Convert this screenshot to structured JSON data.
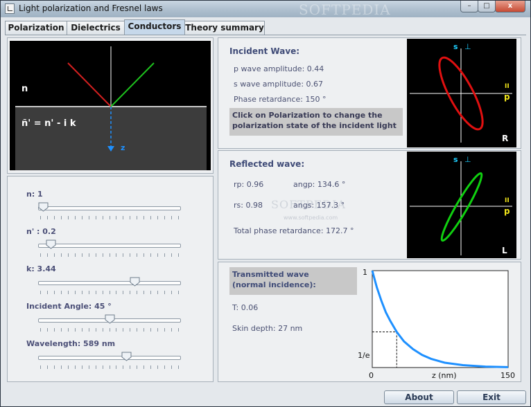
{
  "window": {
    "title": "Light polarization and Fresnel laws",
    "watermark": "SOFTPEDIA",
    "controls": {
      "minimize": "–",
      "maximize": "□",
      "close": "x"
    }
  },
  "tabs": [
    {
      "label": "Polarization",
      "active": false
    },
    {
      "label": "Dielectrics",
      "active": false
    },
    {
      "label": "Conductors",
      "active": true
    },
    {
      "label": "Theory summary",
      "active": false
    }
  ],
  "diagram": {
    "n_label": "n",
    "complex_n_label": "ñ' = n' - i k",
    "z_label": "z",
    "colors": {
      "incident": "#d42020",
      "reflected": "#1ec21e",
      "axis": "#1e90ff"
    }
  },
  "sliders": [
    {
      "label": "n: 1",
      "value": 0.0
    },
    {
      "label": "n' : 0.2",
      "value": 0.06
    },
    {
      "label": "k: 3.44",
      "value": 0.69
    },
    {
      "label": "Incident Angle: 45 °",
      "value": 0.5
    },
    {
      "label": "Wavelength: 589 nm",
      "value": 0.63
    }
  ],
  "incident": {
    "header": "Incident Wave:",
    "p_amp": "p wave amplitude: 0.44",
    "s_amp": "s wave amplitude: 0.67",
    "phase": "Phase retardance: 150 °",
    "note_line1": "Click on Polarization to change the",
    "note_line2": "polarization state of the incident light",
    "plot": {
      "s_label": "s",
      "perp": "⊥",
      "par": "II",
      "p_label": "p",
      "handedness": "R",
      "color": "#e01010"
    }
  },
  "reflected": {
    "header": "Reflected wave:",
    "rp": "rp: 0.96",
    "angp": "angp: 134.6 °",
    "rs": "rs: 0.98",
    "angs": "angs: 157.3 °",
    "total_phase": "Total phase retardance: 172.7 °",
    "watermark": "SOFTPEDIA",
    "watermark_url": "www.softpedia.com",
    "plot": {
      "s_label": "s",
      "perp": "⊥",
      "par": "II",
      "p_label": "p",
      "handedness": "L",
      "color": "#10d010"
    }
  },
  "transmitted": {
    "header_line1": "Transmitted wave",
    "header_line2": "(normal incidence):",
    "T": "T: 0.06",
    "skin_depth": "Skin depth: 27 nm",
    "chart_labels": {
      "y_top": "1",
      "y_mark": "1/e",
      "x_min": "0",
      "x_label": "z (nm)",
      "x_max": "150"
    }
  },
  "chart_data": {
    "type": "line",
    "title": "",
    "xlabel": "z (nm)",
    "ylabel": "",
    "xlim": [
      0,
      150
    ],
    "ylim": [
      0,
      1
    ],
    "x_ticks": [
      "0",
      "150"
    ],
    "y_ticks": [
      "1"
    ],
    "markers": [
      {
        "label": "1/e",
        "x": 27,
        "y": 0.368
      }
    ],
    "series": [
      {
        "x": [
          0,
          5,
          10,
          15,
          20,
          27,
          35,
          45,
          55,
          65,
          80,
          100,
          125,
          150
        ],
        "y": [
          1.0,
          0.83,
          0.69,
          0.57,
          0.48,
          0.368,
          0.27,
          0.19,
          0.13,
          0.09,
          0.05,
          0.025,
          0.01,
          0.004
        ],
        "color": "#1e90ff"
      }
    ],
    "grid": false
  },
  "buttons": {
    "about": "About",
    "exit": "Exit"
  }
}
